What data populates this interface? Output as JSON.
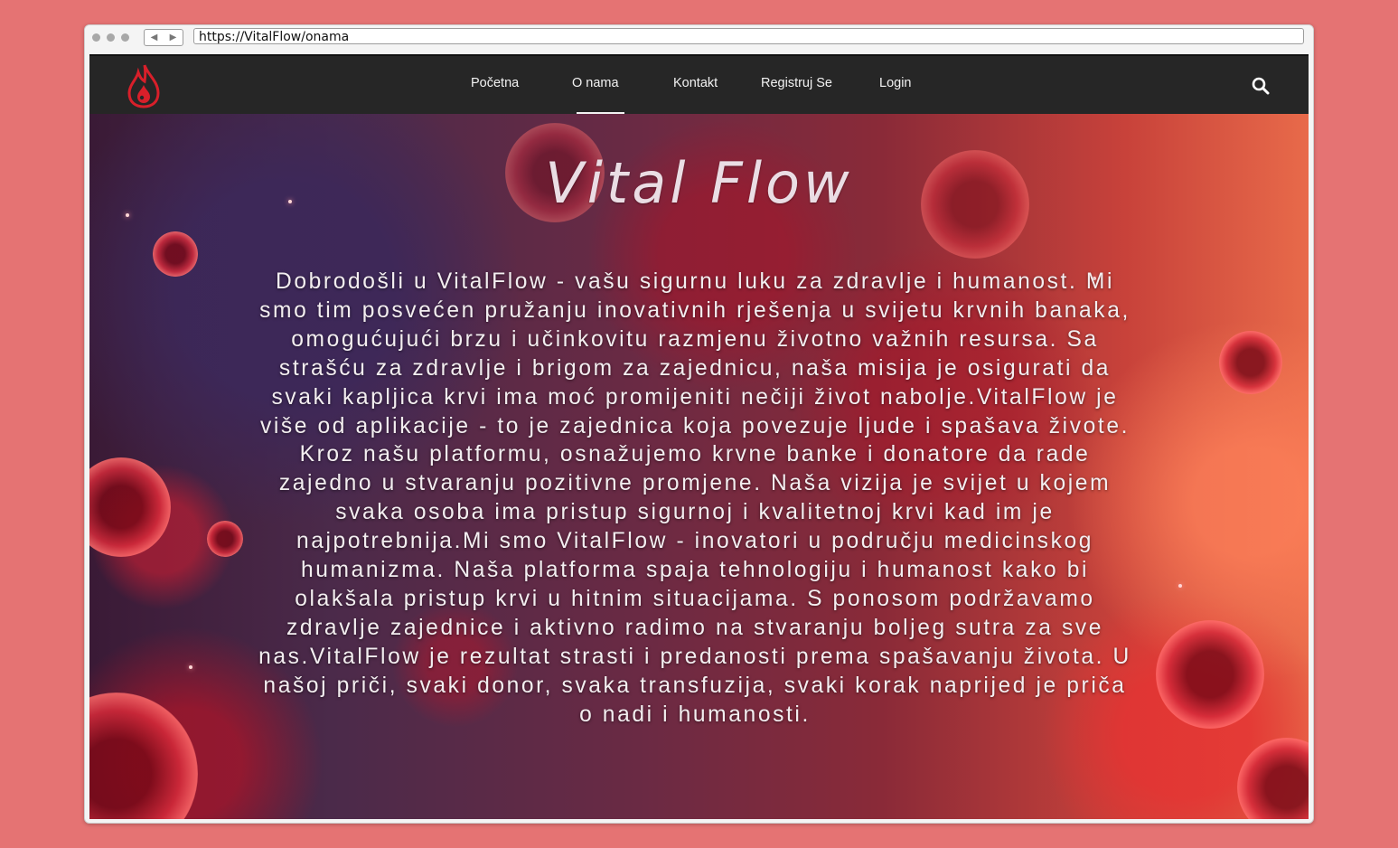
{
  "browser": {
    "url": "https://VitalFlow/onama"
  },
  "navbar": {
    "logo_icon": "blood-drop-flame-icon",
    "items": [
      {
        "label": "Početna"
      },
      {
        "label": "O nama",
        "active": true
      },
      {
        "label": "Kontakt"
      },
      {
        "label": "Registruj Se"
      },
      {
        "label": "Login"
      }
    ],
    "search_icon": "search-icon"
  },
  "hero": {
    "title": "Vital Flow",
    "text": "Dobrodošli u VitalFlow - vašu sigurnu luku za zdravlje i humanost. Mi smo tim posvećen pružanju inovativnih rješenja u svijetu krvnih banaka, omogućujući brzu i učinkovitu razmjenu životno važnih resursa. Sa strašću za zdravlje i brigom za zajednicu, naša misija je osigurati da svaki kapljica krvi ima moć promijeniti nečiji život nabolje.VitalFlow je više od aplikacije - to je zajednica koja povezuje ljude i spašava živote.   Kroz našu platformu, osnažujemo krvne banke i donatore da rade zajedno u stvaranju pozitivne promjene. Naša vizija je svijet u kojem svaka osoba ima pristup sigurnoj i kvalitetnoj krvi kad im je najpotrebnija.Mi smo VitalFlow - inovatori u području medicinskog humanizma. Naša platforma spaja tehnologiju i humanost kako bi olakšala pristup krvi u hitnim situacijama. S ponosom podržavamo zdravlje zajednice i aktivno radimo na stvaranju boljeg sutra za sve nas.VitalFlow je rezultat strasti i predanosti prema spašavanju života.  U našoj priči, svaki donor, svaka transfuzija, svaki korak naprijed je priča o nadi i humanosti."
  },
  "colors": {
    "page_background": "#e57373",
    "navbar": "#262626",
    "nav_text": "#f2f2f2",
    "logo": "#d81f2a"
  }
}
